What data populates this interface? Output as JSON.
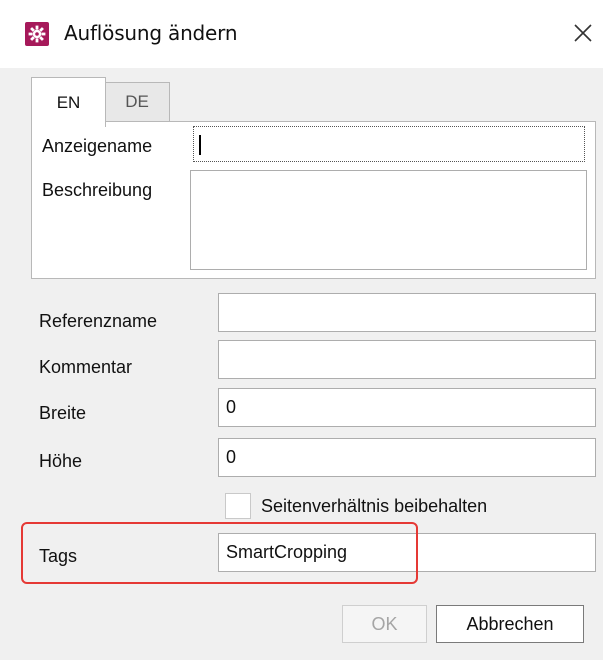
{
  "window": {
    "title": "Auflösung ändern",
    "icon": "gear-icon",
    "accent_color": "#a6195a",
    "close_icon": "close-icon"
  },
  "tabs": [
    {
      "label": "EN",
      "active": true
    },
    {
      "label": "DE",
      "active": false
    }
  ],
  "localized": {
    "display_name_label": "Anzeigename",
    "display_name_value": "",
    "description_label": "Beschreibung",
    "description_value": ""
  },
  "fields": {
    "reference_name_label": "Referenzname",
    "reference_name_value": "",
    "comment_label": "Kommentar",
    "comment_value": "",
    "width_label": "Breite",
    "width_value": "0",
    "height_label": "Höhe",
    "height_value": "0",
    "keep_aspect_label": "Seitenverhältnis beibehalten",
    "keep_aspect_checked": false,
    "tags_label": "Tags",
    "tags_value": "SmartCropping"
  },
  "buttons": {
    "ok_label": "OK",
    "ok_enabled": false,
    "cancel_label": "Abbrechen"
  },
  "annotation": {
    "highlight_color": "#e53935"
  }
}
